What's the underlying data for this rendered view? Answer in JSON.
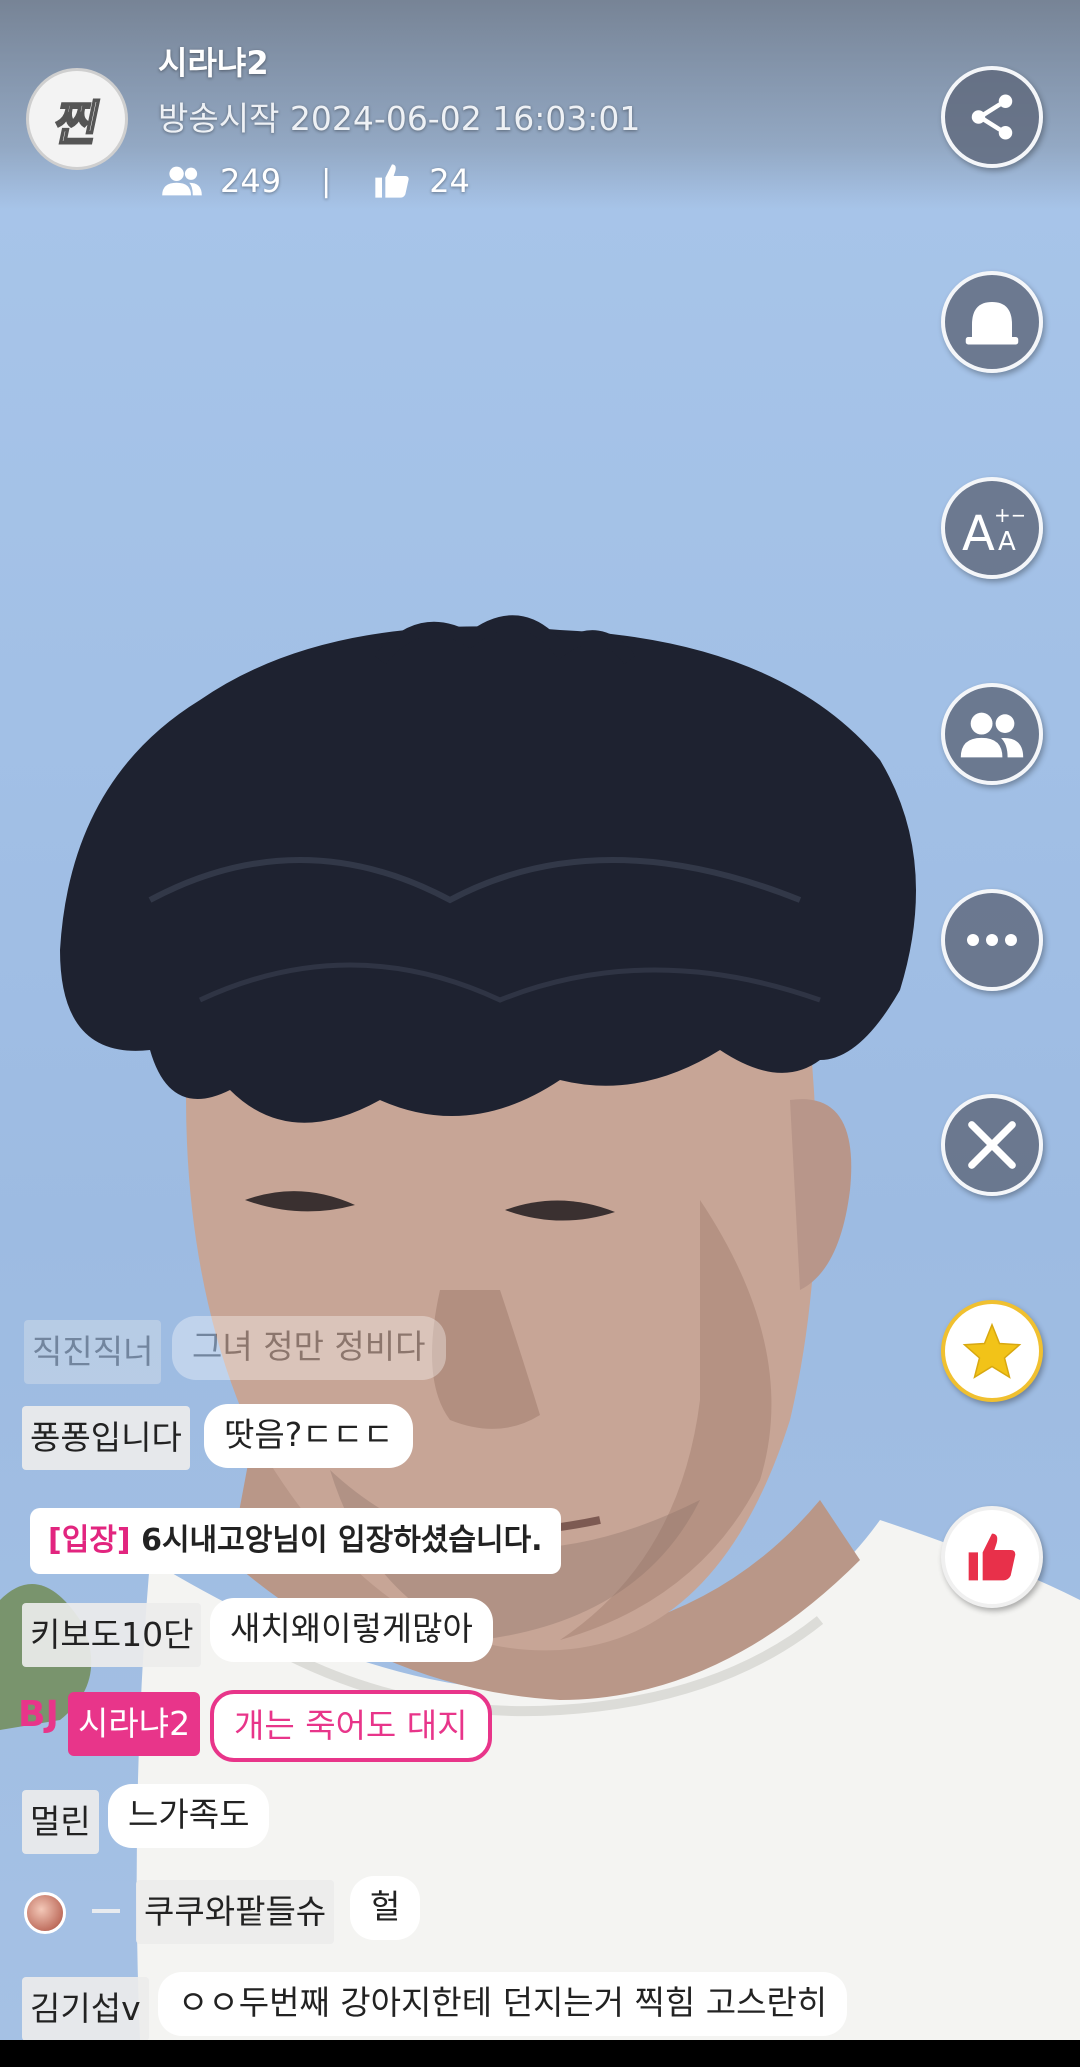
{
  "header": {
    "logo_text": "찐",
    "streamer_name": "시라냐2",
    "broadcast_start": "방송시작 2024-06-02 16:03:01",
    "viewers": "249",
    "separator": "|",
    "likes": "24"
  },
  "right_buttons": [
    {
      "name": "share-button",
      "icon": "share-icon"
    },
    {
      "name": "notification-button",
      "icon": "bell-icon"
    },
    {
      "name": "font-size-button",
      "icon": "font-size-icon",
      "label": "A",
      "sub": "+-A"
    },
    {
      "name": "viewers-button",
      "icon": "people-icon"
    },
    {
      "name": "more-button",
      "icon": "more-icon"
    },
    {
      "name": "close-button",
      "icon": "close-icon"
    },
    {
      "name": "favorite-button",
      "icon": "star-icon"
    },
    {
      "name": "like-button",
      "icon": "thumbs-up-icon"
    }
  ],
  "chat": {
    "faded": {
      "nick": "직진직너",
      "msg": "그녀 정만 정비다"
    },
    "messages": [
      {
        "nick": "퐁퐁입니다",
        "msg": "땃음?ㄷㄷㄷ"
      },
      {
        "nick": "키보도10단",
        "msg": "새치왜이렇게많아"
      },
      {
        "nick": "멀린",
        "msg": "느가족도"
      },
      {
        "nick": "쿠쿠와팥들슈",
        "msg": "헐"
      },
      {
        "nick": "김기섭v",
        "msg": "ㅇㅇ두번째 강아지한테 던지는거 찍힘 고스란히"
      }
    ],
    "system": {
      "tag": "[입장]",
      "text": " 6시내고앙님이 입장하셨습니다."
    },
    "bj": {
      "tag": "BJ",
      "nick": "시라냐2",
      "msg": "개는 죽어도 대지"
    }
  },
  "colors": {
    "accent": "#e8358a",
    "button_bg": "#5f697d",
    "star": "#f2c318",
    "like": "#e8304a"
  }
}
